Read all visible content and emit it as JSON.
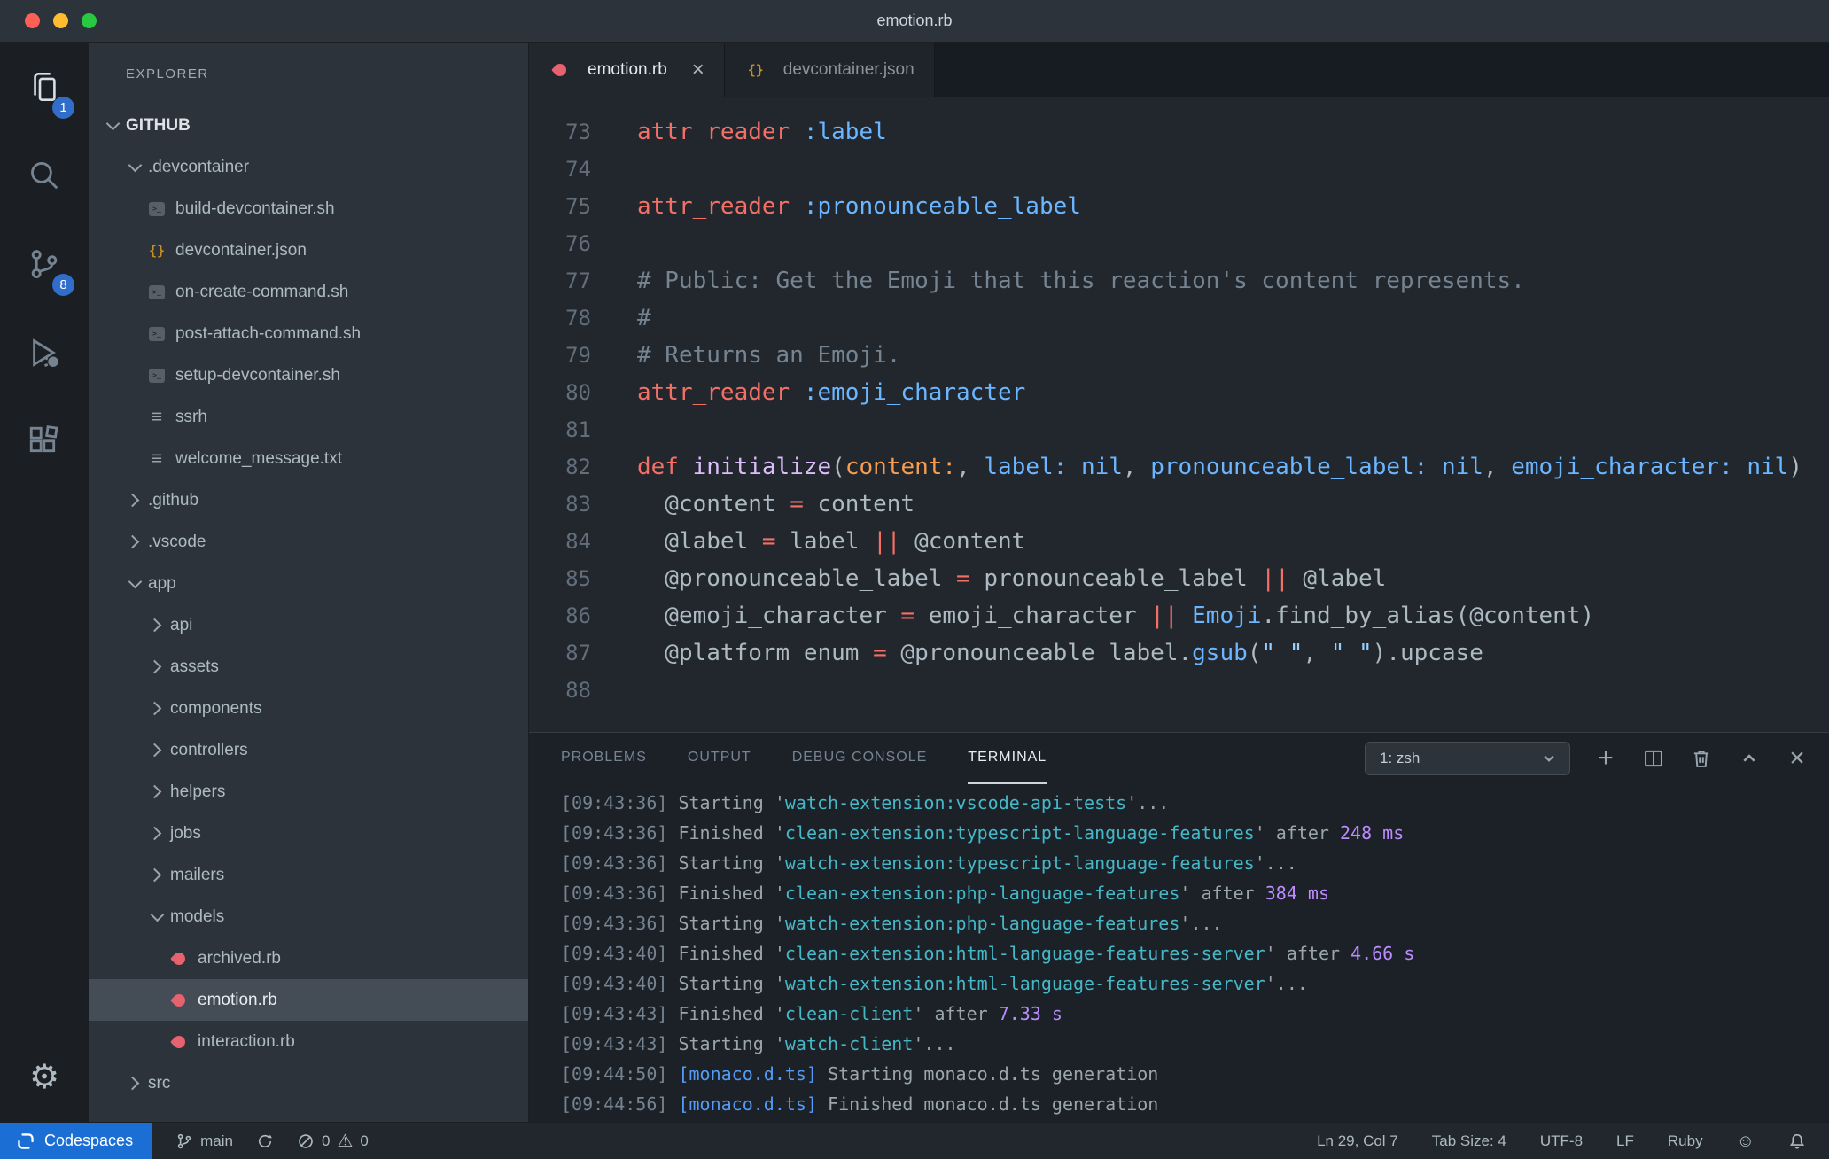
{
  "window": {
    "title": "emotion.rb"
  },
  "icons": {
    "gear": "⚙",
    "smiley": "☺",
    "plus": "+",
    "close": "×",
    "warning": "⚠"
  },
  "colors": {
    "accent_blue": "#316dca",
    "remote_blue": "#1b6fd4",
    "ruby_red": "#e5626e",
    "json_yellow": "#c69026",
    "keyword_red": "#f47067",
    "symbol_blue": "#6cb6ff",
    "string_blue": "#96d0ff",
    "comment_gray": "#768390"
  },
  "activity_bar": {
    "explorer_badge": "1",
    "source_control_badge": "8"
  },
  "sidebar": {
    "title": "EXPLORER",
    "tree": [
      {
        "label": "GITHUB",
        "chev": "chev-down",
        "indent": 0,
        "root": true
      },
      {
        "label": ".devcontainer",
        "chev": "chev-down",
        "indent": 1
      },
      {
        "label": "build-devcontainer.sh",
        "icon": "icon-shell",
        "indent": 2
      },
      {
        "label": "devcontainer.json",
        "icon": "icon-json",
        "indent": 2
      },
      {
        "label": "on-create-command.sh",
        "icon": "icon-shell",
        "indent": 2
      },
      {
        "label": "post-attach-command.sh",
        "icon": "icon-shell",
        "indent": 2
      },
      {
        "label": "setup-devcontainer.sh",
        "icon": "icon-shell",
        "indent": 2
      },
      {
        "label": "ssrh",
        "icon": "icon-text",
        "indent": 2
      },
      {
        "label": "welcome_message.txt",
        "icon": "icon-text",
        "indent": 2
      },
      {
        "label": ".github",
        "chev": "chev-right",
        "indent": 1
      },
      {
        "label": ".vscode",
        "chev": "chev-right",
        "indent": 1
      },
      {
        "label": "app",
        "chev": "chev-down",
        "indent": 1
      },
      {
        "label": "api",
        "chev": "chev-right",
        "indent": 2
      },
      {
        "label": "assets",
        "chev": "chev-right",
        "indent": 2
      },
      {
        "label": "components",
        "chev": "chev-right",
        "indent": 2
      },
      {
        "label": "controllers",
        "chev": "chev-right",
        "indent": 2
      },
      {
        "label": "helpers",
        "chev": "chev-right",
        "indent": 2
      },
      {
        "label": "jobs",
        "chev": "chev-right",
        "indent": 2
      },
      {
        "label": "mailers",
        "chev": "chev-right",
        "indent": 2
      },
      {
        "label": "models",
        "chev": "chev-down",
        "indent": 2
      },
      {
        "label": "archived.rb",
        "icon": "icon-ruby",
        "indent": 3
      },
      {
        "label": "emotion.rb",
        "icon": "icon-ruby",
        "indent": 3,
        "selected": true
      },
      {
        "label": "interaction.rb",
        "icon": "icon-ruby",
        "indent": 3
      },
      {
        "label": "src",
        "chev": "chev-right",
        "indent": 1
      }
    ]
  },
  "editor": {
    "tabs": [
      {
        "label": "emotion.rb",
        "icon": "icon-ruby",
        "active": true,
        "close": "×"
      },
      {
        "label": "devcontainer.json",
        "icon": "icon-json"
      }
    ],
    "lines": [
      {
        "n": "73",
        "toks": [
          {
            "t": "attr_reader",
            "c": "kw"
          },
          {
            "t": " ",
            "c": "pl"
          },
          {
            "t": ":label",
            "c": "bl"
          }
        ]
      },
      {
        "n": "74",
        "toks": []
      },
      {
        "n": "75",
        "toks": [
          {
            "t": "attr_reader",
            "c": "kw"
          },
          {
            "t": " ",
            "c": "pl"
          },
          {
            "t": ":pronounceable_label",
            "c": "bl"
          }
        ]
      },
      {
        "n": "76",
        "toks": []
      },
      {
        "n": "77",
        "toks": [
          {
            "t": "# Public: Get the Emoji that this reaction's content represents.",
            "c": "co"
          }
        ]
      },
      {
        "n": "78",
        "toks": [
          {
            "t": "#",
            "c": "co"
          }
        ]
      },
      {
        "n": "79",
        "toks": [
          {
            "t": "# Returns an Emoji.",
            "c": "co"
          }
        ]
      },
      {
        "n": "80",
        "toks": [
          {
            "t": "attr_reader",
            "c": "kw"
          },
          {
            "t": " ",
            "c": "pl"
          },
          {
            "t": ":emoji_character",
            "c": "bl"
          }
        ]
      },
      {
        "n": "81",
        "toks": []
      },
      {
        "n": "82",
        "toks": [
          {
            "t": "def",
            "c": "kw"
          },
          {
            "t": " ",
            "c": "pl"
          },
          {
            "t": "initialize",
            "c": "fn"
          },
          {
            "t": "(",
            "c": "pl"
          },
          {
            "t": "content:",
            "c": "or"
          },
          {
            "t": ", ",
            "c": "pl"
          },
          {
            "t": "label:",
            "c": "bl"
          },
          {
            "t": " ",
            "c": "pl"
          },
          {
            "t": "nil",
            "c": "bl"
          },
          {
            "t": ", ",
            "c": "pl"
          },
          {
            "t": "pronounceable_label:",
            "c": "bl"
          },
          {
            "t": " ",
            "c": "pl"
          },
          {
            "t": "nil",
            "c": "bl"
          },
          {
            "t": ", ",
            "c": "pl"
          },
          {
            "t": "emoji_character:",
            "c": "bl"
          },
          {
            "t": " ",
            "c": "pl"
          },
          {
            "t": "nil",
            "c": "bl"
          },
          {
            "t": ")",
            "c": "pl"
          }
        ]
      },
      {
        "n": "83",
        "toks": [
          {
            "t": "  @content ",
            "c": "pl"
          },
          {
            "t": "=",
            "c": "kw"
          },
          {
            "t": " content",
            "c": "pl"
          }
        ]
      },
      {
        "n": "84",
        "toks": [
          {
            "t": "  @label ",
            "c": "pl"
          },
          {
            "t": "=",
            "c": "kw"
          },
          {
            "t": " label ",
            "c": "pl"
          },
          {
            "t": "||",
            "c": "kw"
          },
          {
            "t": " @content",
            "c": "pl"
          }
        ]
      },
      {
        "n": "85",
        "toks": [
          {
            "t": "  @pronounceable_label ",
            "c": "pl"
          },
          {
            "t": "=",
            "c": "kw"
          },
          {
            "t": " pronounceable_label ",
            "c": "pl"
          },
          {
            "t": "||",
            "c": "kw"
          },
          {
            "t": " @label",
            "c": "pl"
          }
        ]
      },
      {
        "n": "86",
        "toks": [
          {
            "t": "  @emoji_character ",
            "c": "pl"
          },
          {
            "t": "=",
            "c": "kw"
          },
          {
            "t": " emoji_character ",
            "c": "pl"
          },
          {
            "t": "||",
            "c": "kw"
          },
          {
            "t": " ",
            "c": "pl"
          },
          {
            "t": "Emoji",
            "c": "bl"
          },
          {
            "t": ".find_by_alias(@content)",
            "c": "pl"
          }
        ]
      },
      {
        "n": "87",
        "toks": [
          {
            "t": "  @platform_enum ",
            "c": "pl"
          },
          {
            "t": "=",
            "c": "kw"
          },
          {
            "t": " @pronounceable_label.",
            "c": "pl"
          },
          {
            "t": "gsub",
            "c": "bl"
          },
          {
            "t": "(",
            "c": "pl"
          },
          {
            "t": "\" \"",
            "c": "st"
          },
          {
            "t": ", ",
            "c": "pl"
          },
          {
            "t": "\"_\"",
            "c": "st"
          },
          {
            "t": ").upcase",
            "c": "pl"
          }
        ]
      },
      {
        "n": "88",
        "toks": []
      }
    ]
  },
  "panel": {
    "tabs": [
      {
        "label": "PROBLEMS"
      },
      {
        "label": "OUTPUT"
      },
      {
        "label": "DEBUG CONSOLE"
      },
      {
        "label": "TERMINAL",
        "active": true
      }
    ],
    "shell_selector": "1: zsh",
    "terminal": [
      {
        "toks": [
          {
            "t": "[09:43:36] ",
            "c": "ts"
          },
          {
            "t": "Starting '",
            "c": "tp"
          },
          {
            "t": "watch-extension:vscode-api-tests",
            "c": "cy"
          },
          {
            "t": "'...",
            "c": "tp"
          }
        ]
      },
      {
        "toks": [
          {
            "t": "[09:43:36] ",
            "c": "ts"
          },
          {
            "t": "Finished '",
            "c": "tp"
          },
          {
            "t": "clean-extension:typescript-language-features",
            "c": "cy"
          },
          {
            "t": "' after ",
            "c": "tp"
          },
          {
            "t": "248 ms",
            "c": "mg"
          }
        ]
      },
      {
        "toks": [
          {
            "t": "[09:43:36] ",
            "c": "ts"
          },
          {
            "t": "Starting '",
            "c": "tp"
          },
          {
            "t": "watch-extension:typescript-language-features",
            "c": "cy"
          },
          {
            "t": "'...",
            "c": "tp"
          }
        ]
      },
      {
        "toks": [
          {
            "t": "[09:43:36] ",
            "c": "ts"
          },
          {
            "t": "Finished '",
            "c": "tp"
          },
          {
            "t": "clean-extension:php-language-features",
            "c": "cy"
          },
          {
            "t": "' after ",
            "c": "tp"
          },
          {
            "t": "384 ms",
            "c": "mg"
          }
        ]
      },
      {
        "toks": [
          {
            "t": "[09:43:36] ",
            "c": "ts"
          },
          {
            "t": "Starting '",
            "c": "tp"
          },
          {
            "t": "watch-extension:php-language-features",
            "c": "cy"
          },
          {
            "t": "'...",
            "c": "tp"
          }
        ]
      },
      {
        "toks": [
          {
            "t": "[09:43:40] ",
            "c": "ts"
          },
          {
            "t": "Finished '",
            "c": "tp"
          },
          {
            "t": "clean-extension:html-language-features-server",
            "c": "cy"
          },
          {
            "t": "' after ",
            "c": "tp"
          },
          {
            "t": "4.66 s",
            "c": "mg"
          }
        ]
      },
      {
        "toks": [
          {
            "t": "[09:43:40] ",
            "c": "ts"
          },
          {
            "t": "Starting '",
            "c": "tp"
          },
          {
            "t": "watch-extension:html-language-features-server",
            "c": "cy"
          },
          {
            "t": "'...",
            "c": "tp"
          }
        ]
      },
      {
        "toks": [
          {
            "t": "[09:43:43] ",
            "c": "ts"
          },
          {
            "t": "Finished '",
            "c": "tp"
          },
          {
            "t": "clean-client",
            "c": "cy"
          },
          {
            "t": "' after ",
            "c": "tp"
          },
          {
            "t": "7.33 s",
            "c": "mg"
          }
        ]
      },
      {
        "toks": [
          {
            "t": "[09:43:43] ",
            "c": "ts"
          },
          {
            "t": "Starting '",
            "c": "tp"
          },
          {
            "t": "watch-client",
            "c": "cy"
          },
          {
            "t": "'...",
            "c": "tp"
          }
        ]
      },
      {
        "toks": [
          {
            "t": "[09:44:50] ",
            "c": "ts"
          },
          {
            "t": "[monaco.d.ts]",
            "c": "bl2"
          },
          {
            "t": " Starting monaco.d.ts generation",
            "c": "tp"
          }
        ]
      },
      {
        "toks": [
          {
            "t": "[09:44:56] ",
            "c": "ts"
          },
          {
            "t": "[monaco.d.ts]",
            "c": "bl2"
          },
          {
            "t": " Finished monaco.d.ts generation",
            "c": "tp"
          }
        ]
      }
    ]
  },
  "status_bar": {
    "remote": "Codespaces",
    "branch": "main",
    "errors": "0",
    "warnings": "0",
    "right": [
      {
        "label": "Ln 29, Col 7"
      },
      {
        "label": "Tab Size: 4"
      },
      {
        "label": "UTF-8"
      },
      {
        "label": "LF"
      },
      {
        "label": "Ruby"
      }
    ]
  }
}
